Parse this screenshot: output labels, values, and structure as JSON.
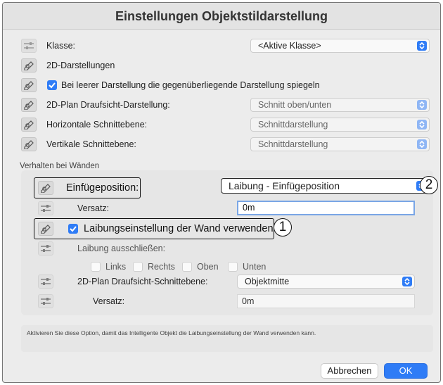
{
  "window": {
    "title": "Einstellungen Objektstildarstellung"
  },
  "top": {
    "klasse_label": "Klasse:",
    "klasse_value": "<Aktive Klasse>",
    "darstellungen_label": "2D-Darstellungen",
    "spiegeln_label": "Bei leerer Darstellung die gegenüberliegende Darstellung spiegeln",
    "spiegeln_checked": true,
    "draufsicht_label": "2D-Plan Draufsicht-Darstellung:",
    "draufsicht_value": "Schnitt oben/unten",
    "horizontal_label": "Horizontale Schnittebene:",
    "horizontal_value": "Schnittdarstellung",
    "vertikal_label": "Vertikale Schnittebene:",
    "vertikal_value": "Schnittdarstellung"
  },
  "walls": {
    "section_title": "Verhalten bei Wänden",
    "einfuege_label": "Einfügeposition:",
    "einfuege_value": "Laibung - Einfügeposition",
    "versatz_label": "Versatz:",
    "versatz_value": "0m",
    "laibung_wand_label": "Laibungseinstellung der Wand verwenden",
    "laibung_wand_checked": true,
    "ausschliessen_label": "Laibung ausschließen:",
    "options": [
      "Links",
      "Rechts",
      "Oben",
      "Unten"
    ],
    "schnittebene_label": "2D-Plan Draufsicht-Schnittebene:",
    "schnittebene_value": "Objektmitte",
    "versatz2_label": "Versatz:",
    "versatz2_value": "0m"
  },
  "info_text": "Aktivieren Sie diese Option, damit das Intelligente Objekt die Laibungseinstellung der Wand verwenden kann.",
  "callouts": [
    "1",
    "2"
  ],
  "buttons": {
    "cancel": "Abbrechen",
    "ok": "OK"
  },
  "icons": {
    "style_icon": "pencil-style-icon",
    "slider_icon": "slider-icon"
  },
  "colors": {
    "accent": "#2f7cf6",
    "window_bg": "#ececec",
    "group_bg": "#e6e6e6"
  }
}
